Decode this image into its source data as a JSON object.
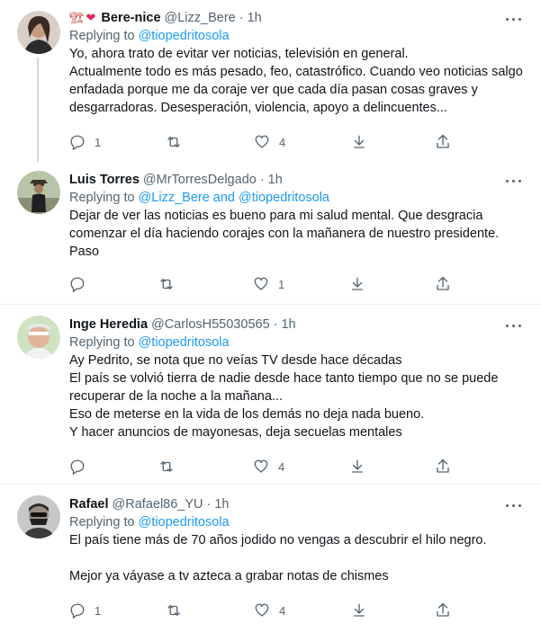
{
  "tweets": [
    {
      "emoji": [
        "🏗",
        "❤"
      ],
      "name": "Bere-nice",
      "handle": "@Lizz_Bere",
      "dot": "·",
      "time": "1h",
      "replying_label": "Replying to ",
      "replying_to": "@tiopedritosola",
      "text": "Yo, ahora trato de evitar ver noticias, televisión en general.\nActualmente todo es más pesado, feo, catastrófico. Cuando veo noticias salgo enfadada porque me da coraje ver que cada día pasan cosas graves y desgarradoras. Desesperación, violencia, apoyo a delincuentes...",
      "reply_count": "1",
      "retweet_count": "",
      "like_count": "4"
    },
    {
      "name": "Luis Torres",
      "handle": "@MrTorresDelgado",
      "dot": "·",
      "time": "1h",
      "replying_label": "Replying to ",
      "replying_to": "@Lizz_Bere and @tiopedritosola",
      "text": "Dejar de ver las noticias es bueno para mi salud mental. Que desgracia comenzar el día haciendo corajes con la mañanera de nuestro presidente.\nPaso",
      "reply_count": "",
      "retweet_count": "",
      "like_count": "1"
    },
    {
      "name": "Inge Heredia",
      "handle": "@CarlosH55030565",
      "dot": "·",
      "time": "1h",
      "replying_label": "Replying to ",
      "replying_to": "@tiopedritosola",
      "text": "Ay Pedrito, se nota que no veías TV desde hace décadas\nEl país se volvió tierra de nadie desde hace tanto tiempo que no se puede recuperar de la noche a la mañana...\nEso de meterse en la vida de los demás no deja nada bueno.\nY hacer anuncios de mayonesas, deja secuelas mentales",
      "reply_count": "",
      "retweet_count": "",
      "like_count": "4"
    },
    {
      "name": "Rafael",
      "handle": "@Rafael86_YU",
      "dot": "·",
      "time": "1h",
      "replying_label": "Replying to ",
      "replying_to": "@tiopedritosola",
      "text": "El país tiene más de 70 años jodido no vengas a descubrir el hilo negro.\n\nMejor ya váyase a tv azteca a grabar notas de chismes",
      "reply_count": "1",
      "retweet_count": "",
      "like_count": "4"
    }
  ],
  "colors": {
    "accent": "#1d9bf0",
    "secondary_text": "#536471",
    "divider": "#eff3f4",
    "thread_line": "#cfd9de"
  }
}
